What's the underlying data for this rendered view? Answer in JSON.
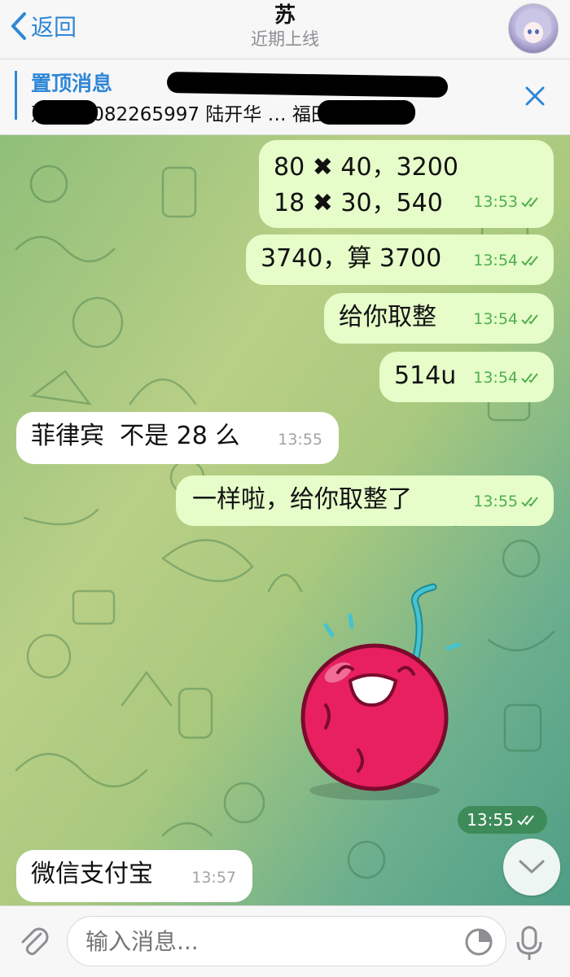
{
  "header": {
    "back_label": "返回",
    "title": "苏",
    "status": "近期上线"
  },
  "pinned": {
    "label": "置顶消息",
    "text": "建设18082265997 陆开华 … 福田路汇 电…"
  },
  "messages": [
    {
      "dir": "out",
      "lines": [
        "80 ✖ 40，3200",
        "18 ✖ 30，540"
      ],
      "time": "13:53"
    },
    {
      "dir": "out",
      "lines": [
        "3740，算 3700"
      ],
      "time": "13:54"
    },
    {
      "dir": "out",
      "lines": [
        "给你取整"
      ],
      "time": "13:54"
    },
    {
      "dir": "out",
      "lines": [
        "514u"
      ],
      "time": "13:54"
    },
    {
      "dir": "in",
      "lines": [
        "菲律宾  不是 28 么"
      ],
      "time": "13:55"
    },
    {
      "dir": "out",
      "lines": [
        "一样啦，给你取整了"
      ],
      "time": "13:55"
    },
    {
      "dir": "in",
      "lines": [
        "微信支付宝"
      ],
      "time": "13:57"
    }
  ],
  "sticker": {
    "icon": "laughing-cherry-sticker",
    "time": "13:55"
  },
  "input": {
    "placeholder": "输入消息..."
  },
  "colors": {
    "accent": "#2f87d6",
    "outgoing_bubble": "#e6fdc9",
    "incoming_bubble": "#ffffff",
    "read_ticks": "#4fae4e"
  }
}
